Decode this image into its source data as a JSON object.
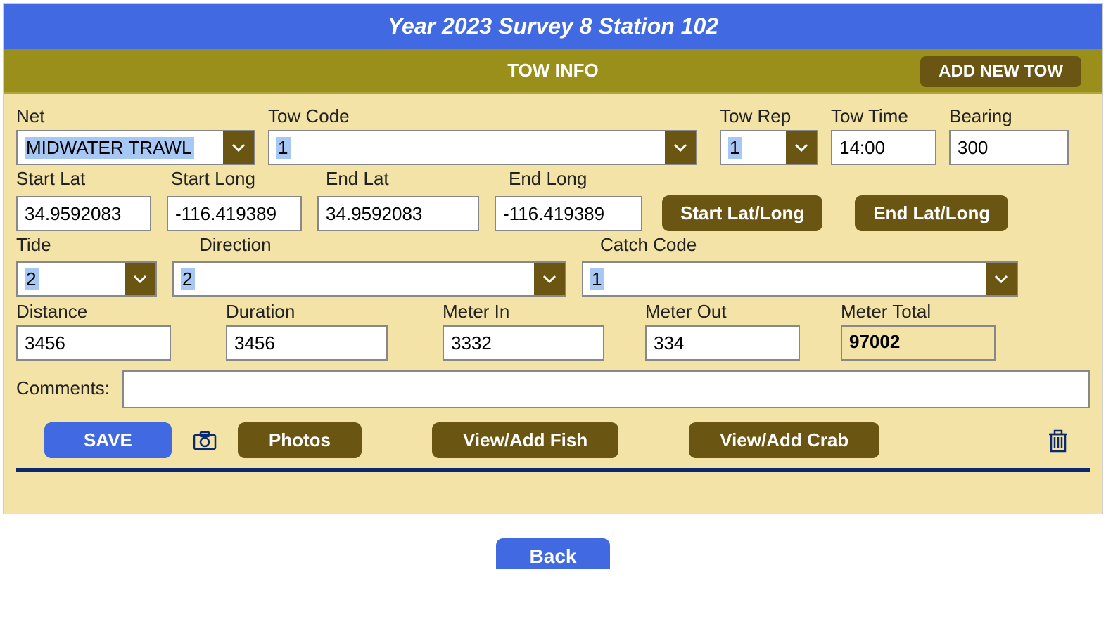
{
  "header": {
    "title": "Year 2023  Survey 8  Station 102"
  },
  "section": {
    "title": "TOW INFO",
    "add_new": "ADD NEW TOW"
  },
  "labels": {
    "net": "Net",
    "tow_code": "Tow Code",
    "tow_rep": "Tow Rep",
    "tow_time": "Tow Time",
    "bearing": "Bearing",
    "start_lat": "Start Lat",
    "start_long": "Start Long",
    "end_lat": "End Lat",
    "end_long": "End Long",
    "tide": "Tide",
    "direction": "Direction",
    "catch_code": "Catch Code",
    "distance": "Distance",
    "duration": "Duration",
    "meter_in": "Meter In",
    "meter_out": "Meter Out",
    "meter_total": "Meter Total",
    "comments": "Comments:"
  },
  "values": {
    "net": "MIDWATER TRAWL",
    "tow_code": "1",
    "tow_rep": "1",
    "tow_time": "14:00",
    "bearing": "300",
    "start_lat": "34.9592083",
    "start_long": "-116.419389",
    "end_lat": "34.9592083",
    "end_long": "-116.419389",
    "tide": "2",
    "direction": "2",
    "catch_code": "1",
    "distance": "3456",
    "duration": "3456",
    "meter_in": "3332",
    "meter_out": "334",
    "meter_total": "97002",
    "comments": ""
  },
  "buttons": {
    "start_latlong": "Start Lat/Long",
    "end_latlong": "End Lat/Long",
    "save": "SAVE",
    "photos": "Photos",
    "view_fish": "View/Add Fish",
    "view_crab": "View/Add Crab",
    "back": "Back"
  }
}
